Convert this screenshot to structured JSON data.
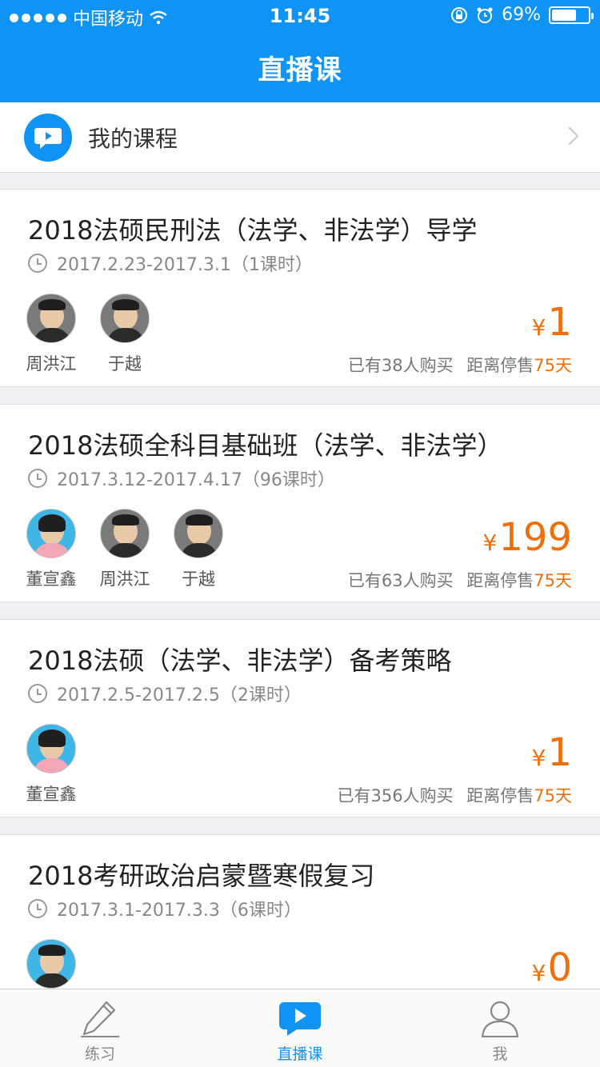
{
  "status": {
    "carrier": "中国移动",
    "time": "11:45",
    "battery": "69%",
    "battery_level": 0.69
  },
  "header": {
    "title": "直播课"
  },
  "my_course": {
    "label": "我的课程"
  },
  "courses": [
    {
      "title": "2018法硕民刑法（法学、非法学）导学",
      "time": "2017.2.23-2017.3.1（1课时）",
      "teachers": [
        "周洪江",
        "于越"
      ],
      "price_symbol": "¥",
      "price": "1",
      "bought": "已有38人购买",
      "stop_label": "距离停售",
      "days": "75天"
    },
    {
      "title": "2018法硕全科目基础班（法学、非法学）",
      "time": "2017.3.12-2017.4.17（96课时）",
      "teachers": [
        "董宣鑫",
        "周洪江",
        "于越"
      ],
      "price_symbol": "¥",
      "price": "199",
      "bought": "已有63人购买",
      "stop_label": "距离停售",
      "days": "75天"
    },
    {
      "title": "2018法硕（法学、非法学）备考策略",
      "time": "2017.2.5-2017.2.5（2课时）",
      "teachers": [
        "董宣鑫"
      ],
      "price_symbol": "¥",
      "price": "1",
      "bought": "已有356人购买",
      "stop_label": "距离停售",
      "days": "75天"
    },
    {
      "title": "2018考研政治启蒙暨寒假复习",
      "time": "2017.3.1-2017.3.3（6课时）",
      "teachers": [
        ""
      ],
      "price_symbol": "¥",
      "price": "0"
    }
  ],
  "tabs": [
    {
      "label": "练习",
      "icon": "pencil-icon"
    },
    {
      "label": "直播课",
      "icon": "live-play-icon"
    },
    {
      "label": "我",
      "icon": "profile-icon"
    }
  ],
  "colors": {
    "primary": "#0f93f5",
    "price": "#f06f0a"
  }
}
